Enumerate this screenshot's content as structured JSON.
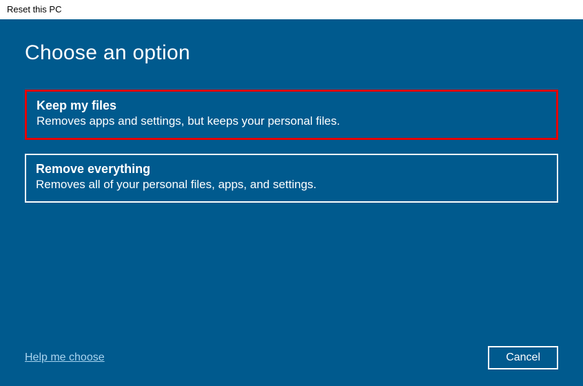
{
  "titlebar": {
    "title": "Reset this PC"
  },
  "dialog": {
    "heading": "Choose an option",
    "options": [
      {
        "title": "Keep my files",
        "desc": "Removes apps and settings, but keeps your personal files."
      },
      {
        "title": "Remove everything",
        "desc": "Removes all of your personal files, apps, and settings."
      }
    ],
    "help_link": "Help me choose",
    "cancel": "Cancel"
  }
}
